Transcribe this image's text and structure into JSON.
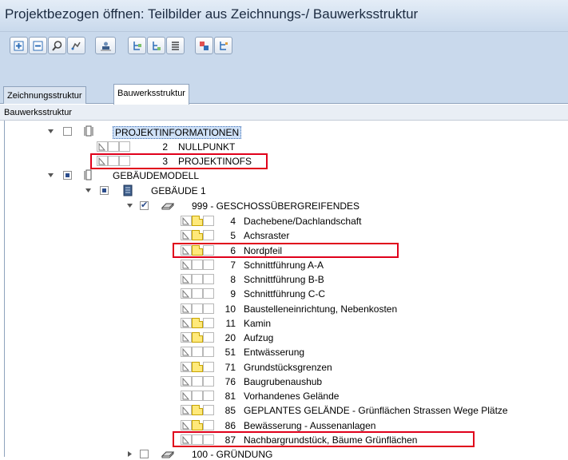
{
  "window": {
    "title": "Projektbezogen öffnen: Teilbilder aus Zeichnungs-/ Bauwerksstruktur"
  },
  "toolbar": {
    "buttons": [
      {
        "name": "expand-all-icon"
      },
      {
        "name": "collapse-all-icon"
      },
      {
        "name": "search-icon"
      },
      {
        "name": "filter-icon"
      },
      {
        "name": "assign-user-icon"
      },
      {
        "name": "insert-structure-icon"
      },
      {
        "name": "insert-level-icon"
      },
      {
        "name": "layer-list-icon"
      },
      {
        "name": "derive-drawing-icon"
      },
      {
        "name": "structure-options-icon"
      }
    ]
  },
  "tabs": [
    {
      "label": "Zeichnungsstruktur",
      "active": false
    },
    {
      "label": "Bauwerksstruktur",
      "active": true
    }
  ],
  "panel": {
    "header": "Bauwerksstruktur"
  },
  "tree": {
    "projektinfo": {
      "label": "PROJEKTINFORMATIONEN"
    },
    "projektinfo_items": [
      {
        "num": "2",
        "label": "NULLPUNKT"
      },
      {
        "num": "3",
        "label": "PROJEKTINOFS"
      }
    ],
    "gebaeudemodell": {
      "label": "GEBÄUDEMODELL"
    },
    "gebaeude": {
      "label": "GEBÄUDE 1"
    },
    "geschoss": {
      "label": "999 - GESCHOSSÜBERGREIFENDES"
    },
    "items": [
      {
        "num": "4",
        "label": "Dachebene/Dachlandschaft",
        "doc": true
      },
      {
        "num": "5",
        "label": "Achsraster",
        "doc": true
      },
      {
        "num": "6",
        "label": "Nordpfeil",
        "doc": true
      },
      {
        "num": "7",
        "label": "Schnittführung A-A",
        "doc": false
      },
      {
        "num": "8",
        "label": "Schnittführung B-B",
        "doc": false
      },
      {
        "num": "9",
        "label": "Schnittführung C-C",
        "doc": false
      },
      {
        "num": "10",
        "label": "Baustelleneinrichtung, Nebenkosten",
        "doc": false
      },
      {
        "num": "11",
        "label": "Kamin",
        "doc": true
      },
      {
        "num": "20",
        "label": "Aufzug",
        "doc": true
      },
      {
        "num": "51",
        "label": "Entwässerung",
        "doc": false
      },
      {
        "num": "71",
        "label": "Grundstücksgrenzen",
        "doc": true
      },
      {
        "num": "76",
        "label": "Baugrubenaushub",
        "doc": false
      },
      {
        "num": "81",
        "label": "Vorhandenes Gelände",
        "doc": false
      },
      {
        "num": "85",
        "label": "GEPLANTES GELÄNDE - Grünflächen Strassen Wege Plätze",
        "doc": true
      },
      {
        "num": "86",
        "label": "Bewässerung - Aussenanlagen",
        "doc": true
      },
      {
        "num": "87",
        "label": "Nachbargrundstück, Bäume Grünflächen",
        "doc": false
      }
    ],
    "gruendung": {
      "label": "100 - GRÜNDUNG"
    }
  },
  "colors": {
    "highlight_box": "#e0001b",
    "selection": "#cfe1f7",
    "titlebar": "#c9d9ec"
  }
}
